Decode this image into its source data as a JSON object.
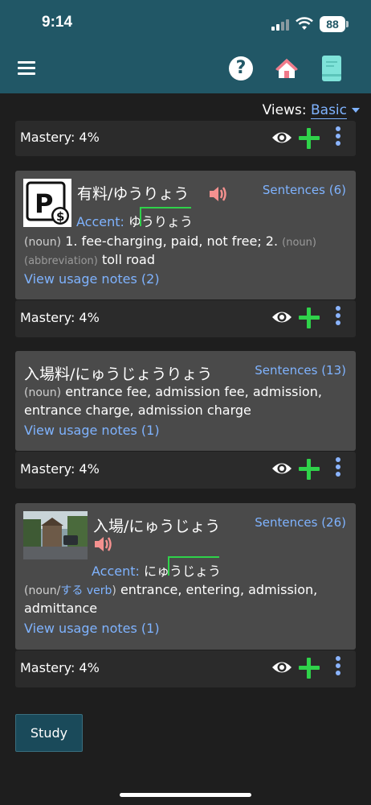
{
  "status_bar": {
    "time": "9:14",
    "battery": "88"
  },
  "toolbar": {
    "help_glyph": "?",
    "menu_icon": "hamburger-icon",
    "home_icon": "home-icon",
    "book_icon": "book-icon"
  },
  "views": {
    "label": "Views:",
    "selected": "Basic"
  },
  "mastery_label": "Mastery: 4%",
  "cards": [
    {
      "term": "有料/ゆうりょう",
      "sentences": "Sentences (6)",
      "accent_label": "Accent:",
      "accent_low": "ゆ",
      "accent_high": "うりょう",
      "pos1": "(noun)",
      "def1": "1. fee-charging, paid, not free; 2.",
      "pos2": "(noun) (abbreviation)",
      "def2": "toll road",
      "usage": "View usage notes (2)"
    },
    {
      "term": "入場料/にゅうじょうりょう",
      "sentences": "Sentences (13)",
      "pos1": "(noun)",
      "def1": "entrance fee, admission fee, admission, entrance charge, admission charge",
      "usage": "View usage notes (1)"
    },
    {
      "term": "入場/にゅうじょう",
      "sentences": "Sentences (26)",
      "accent_label": "Accent:",
      "accent_low": "にゅ",
      "accent_high": "うじょう",
      "pos_open": "(noun/",
      "pos_suru": "する verb",
      "pos_close": ")",
      "def1": "entrance, entering, admission, admittance",
      "usage": "View usage notes (1)"
    }
  ],
  "study_button": "Study"
}
